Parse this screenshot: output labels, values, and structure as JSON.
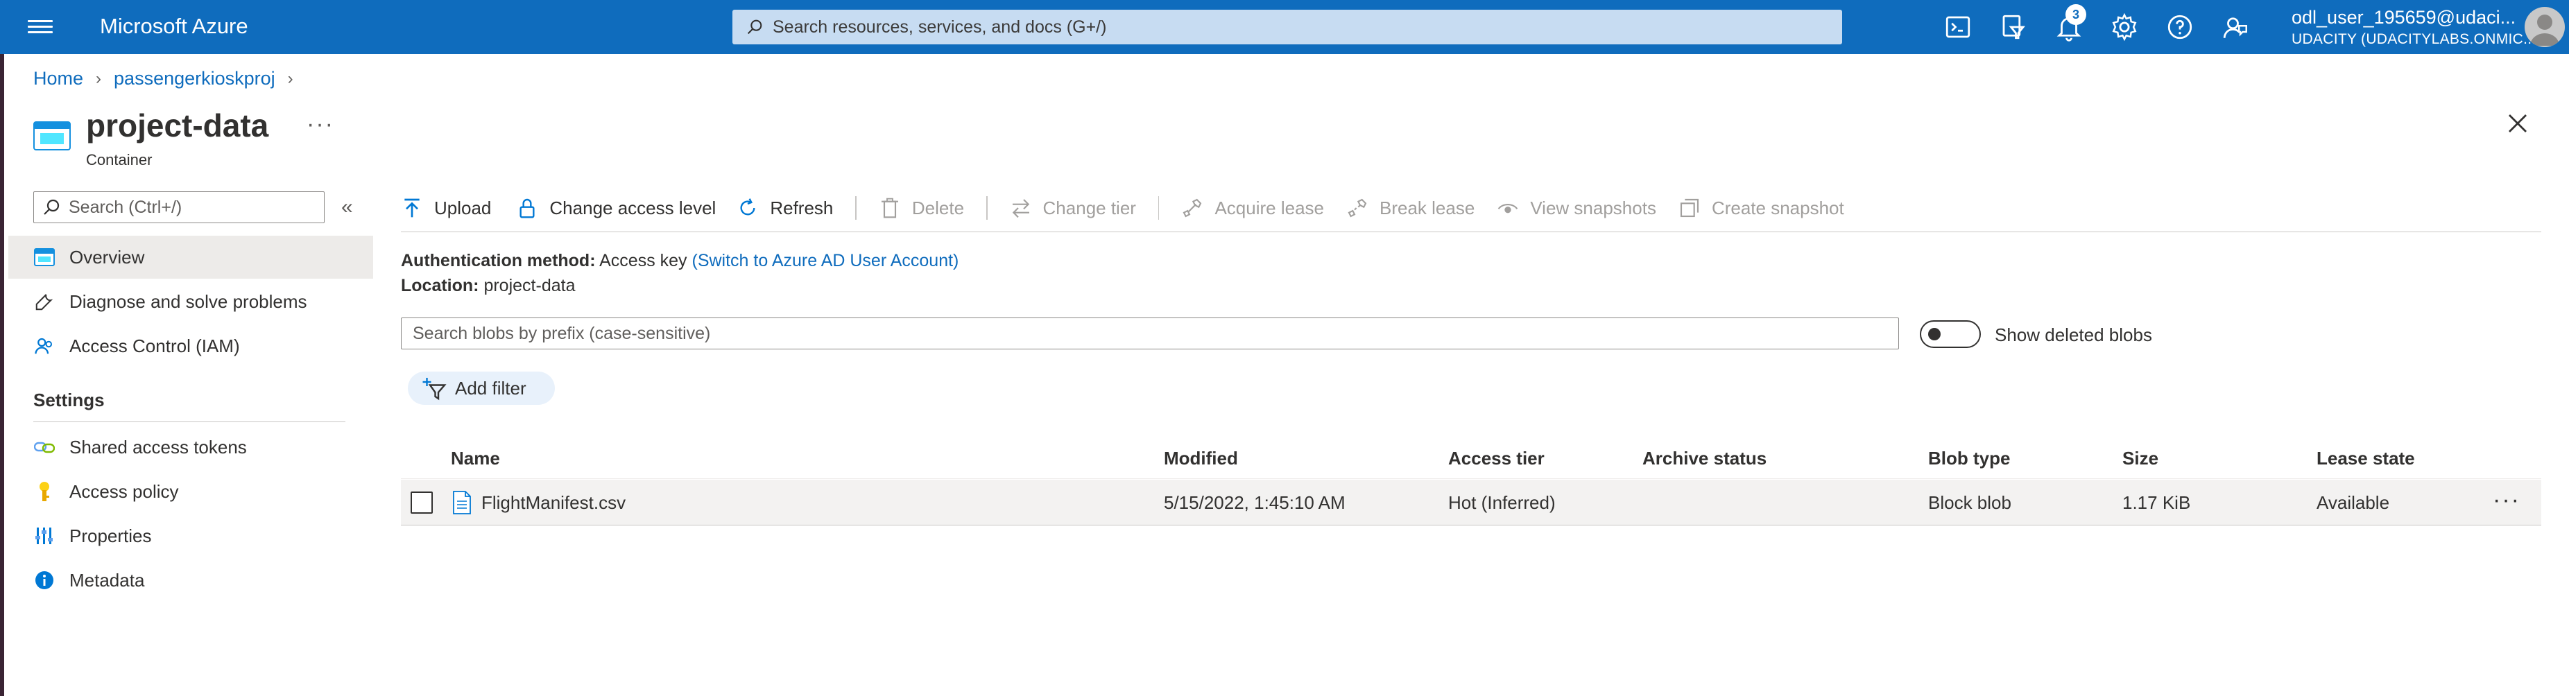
{
  "topbar": {
    "brand": "Microsoft Azure",
    "search_placeholder": "Search resources, services, and docs (G+/)",
    "notification_count": "3",
    "user": "odl_user_195659@udaci...",
    "org": "UDACITY (UDACITYLABS.ONMIC...",
    "accent_color": "#0f6cbd"
  },
  "breadcrumb": {
    "items": [
      "Home",
      "passengerkioskproj"
    ]
  },
  "page": {
    "title": "project-data",
    "subtitle": "Container",
    "more": "···"
  },
  "nav": {
    "search_placeholder": "Search (Ctrl+/)",
    "collapse": "«",
    "items": [
      {
        "label": "Overview",
        "icon": "overview-icon"
      },
      {
        "label": "Diagnose and solve problems",
        "icon": "wrench-icon"
      },
      {
        "label": "Access Control (IAM)",
        "icon": "people-icon"
      }
    ],
    "section": "Settings",
    "settings_items": [
      {
        "label": "Shared access tokens",
        "icon": "link-icon"
      },
      {
        "label": "Access policy",
        "icon": "key-icon"
      },
      {
        "label": "Properties",
        "icon": "properties-icon"
      },
      {
        "label": "Metadata",
        "icon": "info-icon"
      }
    ]
  },
  "toolbar": {
    "upload": "Upload",
    "change_access": "Change access level",
    "refresh": "Refresh",
    "delete": "Delete",
    "change_tier": "Change tier",
    "acquire_lease": "Acquire lease",
    "break_lease": "Break lease",
    "view_snapshots": "View snapshots",
    "create_snapshot": "Create snapshot"
  },
  "info": {
    "auth_label": "Authentication method:",
    "auth_value": "Access key",
    "auth_link": "(Switch to Azure AD User Account)",
    "location_label": "Location:",
    "location_value": "project-data"
  },
  "blob_search": {
    "placeholder": "Search blobs by prefix (case-sensitive)"
  },
  "show_deleted": {
    "label": "Show deleted blobs",
    "enabled": false
  },
  "filter": {
    "label": "Add filter"
  },
  "table": {
    "headers": [
      "Name",
      "Modified",
      "Access tier",
      "Archive status",
      "Blob type",
      "Size",
      "Lease state"
    ],
    "rows": [
      {
        "name": "FlightManifest.csv",
        "modified": "5/15/2022, 1:45:10 AM",
        "access_tier": "Hot (Inferred)",
        "archive_status": "",
        "blob_type": "Block blob",
        "size": "1.17 KiB",
        "lease_state": "Available",
        "more": "···"
      }
    ]
  }
}
